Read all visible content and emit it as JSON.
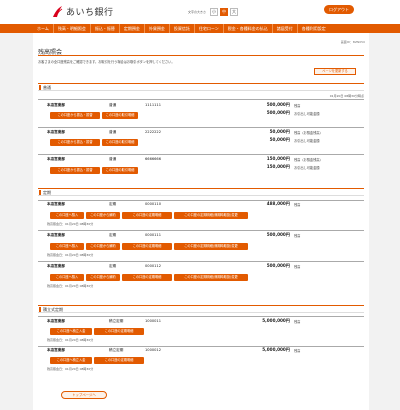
{
  "header": {
    "bank_name": "あいち銀行",
    "font_size_label": "文字の大きさ",
    "font_sizes": [
      "小",
      "中",
      "大"
    ],
    "logout_label": "ログアウト"
  },
  "nav": [
    "ホーム",
    "残高・明細照会",
    "振込・振替",
    "定期預金",
    "外貨預金",
    "投資信託",
    "住宅ローン",
    "税金・各種料金の払込",
    "諸届受付",
    "各種利用設定"
  ],
  "page": {
    "screen_id": "画面ID：BZN050",
    "title": "残高照会",
    "intro": "お客さまの全口座残高をご確認できます。お取引を行う場合はお取引ボタンを押してください。",
    "refresh_label": "ページを更新する",
    "top_button": "トップページへ"
  },
  "colors": {
    "accent": "#e25a00",
    "background": "#f2f2f2"
  },
  "futsu": {
    "heading": "普通",
    "timestamp": "01月20日 08時30分時点",
    "accounts": [
      {
        "branch": "本店営業部",
        "type": "普通",
        "number": "1111111",
        "balance": "500,000円",
        "balance_label": "残高",
        "available": "500,000円",
        "available_label": "お引出し可能金額",
        "buttons": [
          "この口座から振込・振替",
          "この口座の取引明細"
        ]
      },
      {
        "branch": "本店営業部",
        "type": "普通",
        "number": "2222222",
        "balance": "50,000円",
        "balance_label": "残高（お預金残高）",
        "available": "50,000円",
        "available_label": "お引出し可能金額",
        "buttons": [
          "この口座から振込・振替",
          "この口座の取引明細"
        ]
      },
      {
        "branch": "本店営業部",
        "type": "普通",
        "number": "6666666",
        "balance": "150,000円",
        "balance_label": "残高（お預金残高）",
        "available": "150,000円",
        "available_label": "お引出し可能金額",
        "buttons": [
          "この口座から振込・振替",
          "この口座の取引明細"
        ]
      }
    ]
  },
  "teiki": {
    "heading": "定期",
    "accounts": [
      {
        "branch": "本店営業部",
        "type": "定期",
        "number": "0000110",
        "balance": "488,000円",
        "balance_label": "残高",
        "buttons": [
          "この口座へ預入",
          "この口座から解約",
          "この口座の定期明細",
          "この口座の定期明細(満期時取扱)変更"
        ],
        "note": "残高照会日：01月20日 08時30分"
      },
      {
        "branch": "本店営業部",
        "type": "定期",
        "number": "0000111",
        "balance": "500,000円",
        "balance_label": "残高",
        "buttons": [
          "この口座へ預入",
          "この口座から解約",
          "この口座の定期明細",
          "この口座の定期明細(満期時取扱)変更"
        ],
        "note": "残高照会日：01月20日 08時30分"
      },
      {
        "branch": "本店営業部",
        "type": "定期",
        "number": "0000112",
        "balance": "500,000円",
        "balance_label": "残高",
        "buttons": [
          "この口座へ預入",
          "この口座から解約",
          "この口座の定期明細",
          "この口座の定期明細(満期時取扱)変更"
        ],
        "note": "残高照会日：01月20日 08時30分"
      }
    ]
  },
  "tsumitate": {
    "heading": "積立式定期",
    "accounts": [
      {
        "branch": "本店営業部",
        "type": "積立定期",
        "number": "1000011",
        "balance": "5,000,000円",
        "balance_label": "残高",
        "buttons": [
          "この口座へ積立入金",
          "この口座の定期明細"
        ],
        "note": "残高照会日：01月20日 08時30分"
      },
      {
        "branch": "本店営業部",
        "type": "積立定期",
        "number": "1000012",
        "balance": "5,000,000円",
        "balance_label": "残高",
        "buttons": [
          "この口座へ積立入金",
          "この口座の定期明細"
        ],
        "note": "残高照会日：01月20日 08時30分"
      }
    ]
  }
}
